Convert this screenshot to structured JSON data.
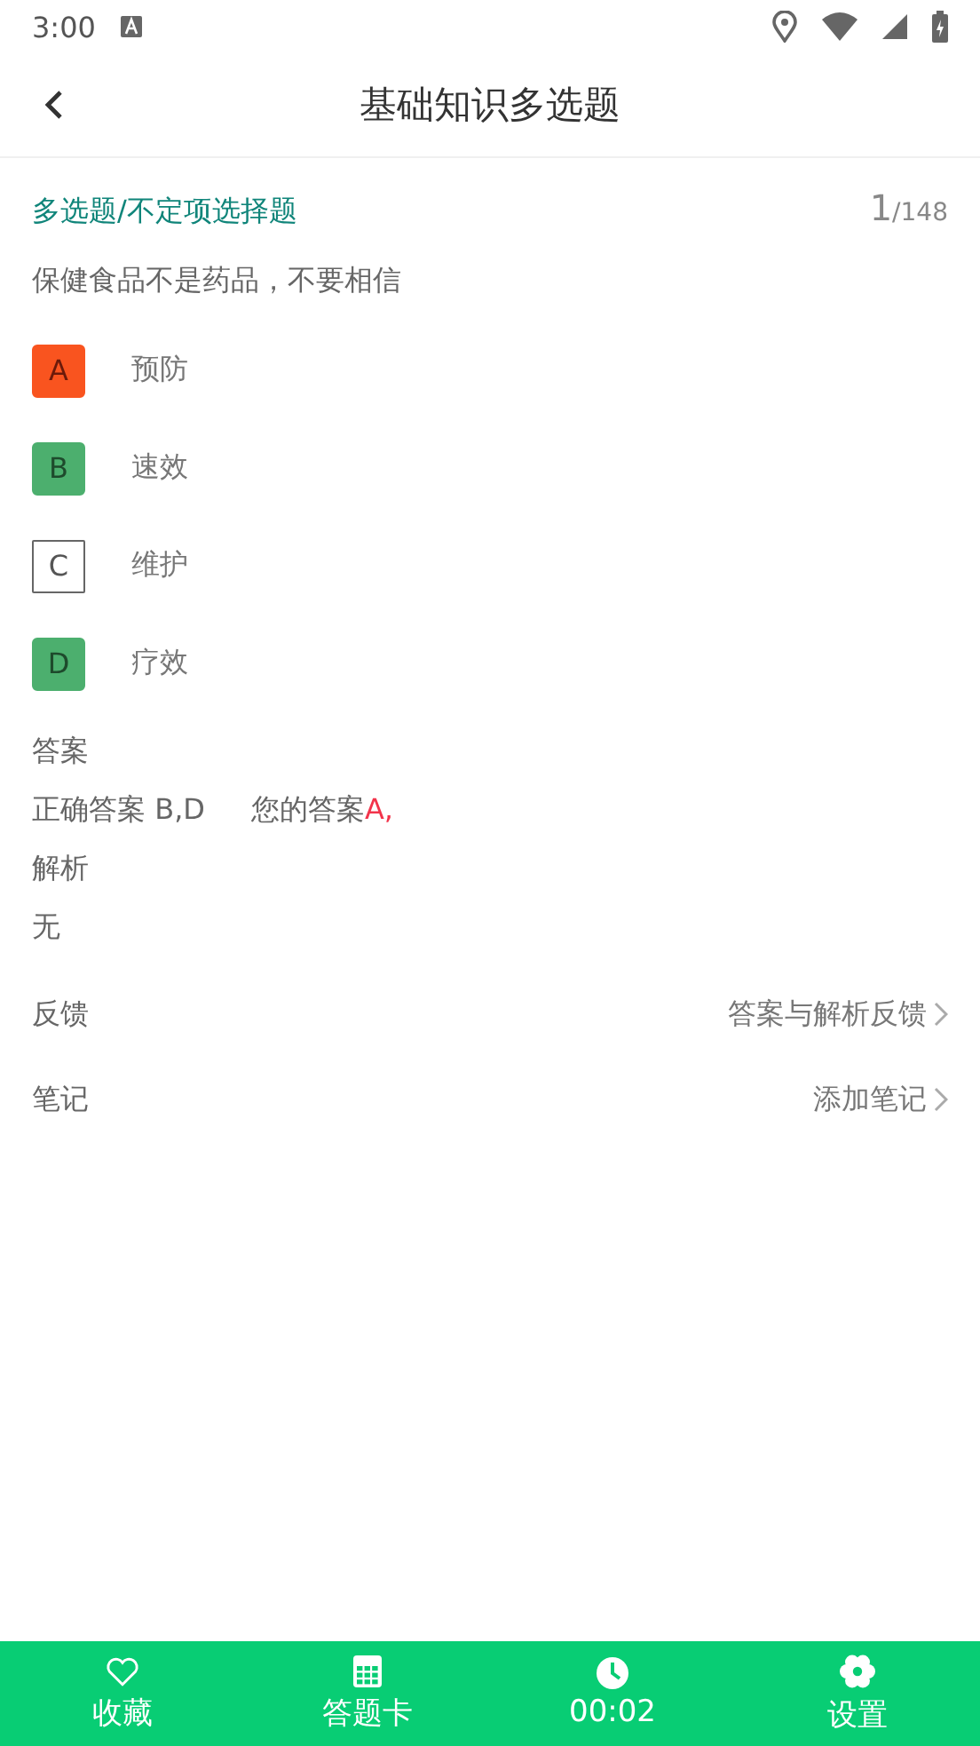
{
  "status_bar": {
    "time": "3:00"
  },
  "header": {
    "title": "基础知识多选题"
  },
  "question": {
    "type_label": "多选题/不定项选择题",
    "current": "1",
    "total": "/148",
    "text": "保健食品不是药品，不要相信"
  },
  "options": [
    {
      "letter": "A",
      "text": "预防",
      "selected": true,
      "correct": false
    },
    {
      "letter": "B",
      "text": "速效",
      "selected": false,
      "correct": true
    },
    {
      "letter": "C",
      "text": "维护",
      "selected": false,
      "correct": false
    },
    {
      "letter": "D",
      "text": "疗效",
      "selected": false,
      "correct": true
    }
  ],
  "answer": {
    "heading": "答案",
    "correct_label": "正确答案 B,D",
    "yours_label": "您的答案",
    "yours_value": "A,"
  },
  "analysis": {
    "heading": "解析",
    "text": "无"
  },
  "links": [
    {
      "label": "反馈",
      "action": "答案与解析反馈"
    },
    {
      "label": "笔记",
      "action": "添加笔记"
    }
  ],
  "bottom_bar": [
    {
      "label": "收藏"
    },
    {
      "label": "答题卡"
    },
    {
      "label": "00:02"
    },
    {
      "label": "设置"
    }
  ]
}
